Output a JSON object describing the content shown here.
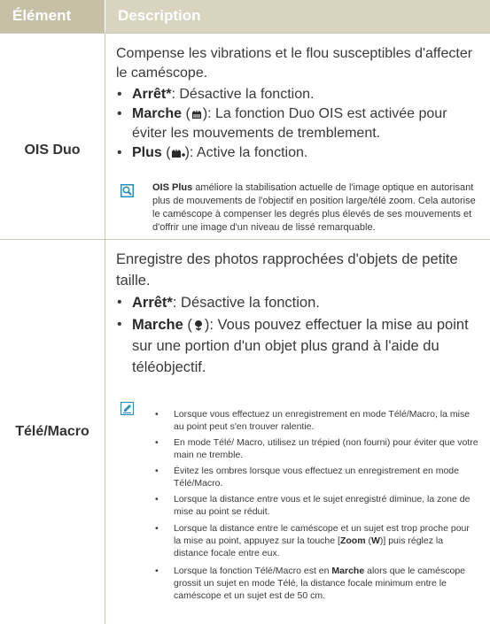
{
  "header": {
    "col1": "Élément",
    "col2": "Description"
  },
  "rows": [
    {
      "label": "OIS Duo",
      "intro": "Compense les vibrations et le flou susceptibles d'affecter le caméscope.",
      "b1_bold": "Arrêt*",
      "b1_text": ": Désactive la fonction.",
      "b2_bold": "Marche",
      "b2_text": "): La fonction Duo OIS est activée pour éviter les mouvements de tremblement.",
      "b3_bold": "Plus",
      "b3_text": "): Active la fonction.",
      "note_bold": "OIS Plus",
      "note_text": " améliore la stabilisation actuelle de l'image optique en autorisant plus de mouvements de l'objectif en position large/télé zoom. Cela autorise le caméscope à compenser les degrés plus élevés de ses mouvements et d'offrir une image d'un niveau de lissé remarquable."
    },
    {
      "label": "Télé/Macro",
      "intro": "Enregistre des photos rapprochées d'objets de petite taille.",
      "b1_bold": "Arrêt*",
      "b1_text": ": Désactive la fonction.",
      "b2_bold": "Marche",
      "b2_text": "): Vous pouvez effectuer la mise au point sur une portion d'un objet plus grand à l'aide du téléobjectif.",
      "notes": [
        "Lorsque vous effectuez un enregistrement en mode Télé/Macro, la mise au point peut s'en trouver ralentie.",
        "En mode Télé/ Macro, utilisez un trépied (non fourni) pour éviter que votre main ne tremble.",
        "Évitez les ombres lorsque vous effectuez un enregistrement en mode Télé/Macro.",
        "Lorsque la distance entre vous et le sujet enregistré diminue, la zone de mise au point se réduit."
      ],
      "note5_a": "Lorsque la distance entre le caméscope et un sujet est trop proche pour la mise au point, appuyez sur la touche [",
      "note5_zoom": "Zoom",
      "note5_b": " (",
      "note5_w": "W",
      "note5_c": ")] puis réglez la distance focale entre eux.",
      "note6_a": "Lorsque la fonction Télé/Macro est en ",
      "note6_bold": "Marche",
      "note6_b": " alors que le caméscope grossit un sujet en mode Télé, la distance focale minimum entre le caméscope et un sujet est de 50 cm."
    }
  ],
  "colors": {
    "header_left": "#c5c0a6",
    "header_right": "#d8d4bf",
    "icon_blue": "#2a8dc0"
  },
  "icons": [
    "magnifier-note-icon",
    "pencil-note-icon",
    "ois-duo-icon",
    "ois-plus-icon",
    "tulip-macro-icon"
  ]
}
